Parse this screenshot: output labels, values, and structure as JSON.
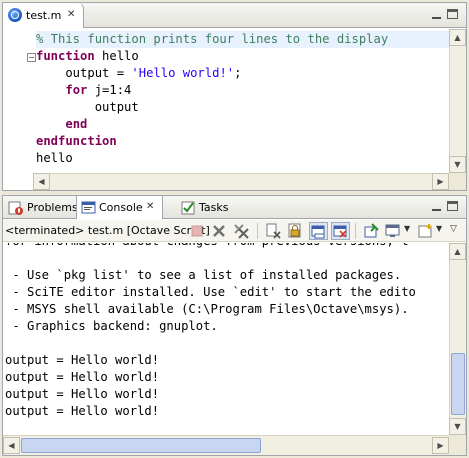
{
  "editor": {
    "tab_label": "test.m",
    "tab_close": "✕",
    "lines": [
      {
        "parts": [
          {
            "text": "% This function prints four lines to the display",
            "cls": "tok-comment"
          }
        ]
      },
      {
        "parts": [
          {
            "text": "function",
            "cls": "tok-kw"
          },
          {
            "text": " hello",
            "cls": ""
          }
        ]
      },
      {
        "parts": [
          {
            "text": "    output = ",
            "cls": ""
          },
          {
            "text": "'Hello world!'",
            "cls": "tok-str"
          },
          {
            "text": ";",
            "cls": ""
          }
        ]
      },
      {
        "parts": [
          {
            "text": "    ",
            "cls": ""
          },
          {
            "text": "for",
            "cls": "tok-kw"
          },
          {
            "text": " j=1:4",
            "cls": ""
          }
        ]
      },
      {
        "parts": [
          {
            "text": "        output",
            "cls": ""
          }
        ]
      },
      {
        "parts": [
          {
            "text": "    ",
            "cls": ""
          },
          {
            "text": "end",
            "cls": "tok-kw"
          }
        ]
      },
      {
        "parts": [
          {
            "text": "endfunction",
            "cls": "tok-kw"
          }
        ]
      },
      {
        "parts": [
          {
            "text": "hello",
            "cls": ""
          }
        ]
      }
    ]
  },
  "views": {
    "tabs": [
      {
        "label": "Problems",
        "icon": "problems-icon"
      },
      {
        "label": "Console",
        "icon": "console-icon",
        "close": "✕"
      },
      {
        "label": "Tasks",
        "icon": "tasks-icon"
      }
    ]
  },
  "console": {
    "title": "<terminated> test.m [Octave Script]",
    "lines": [
      "for information about changes from previous versions, t",
      "",
      " - Use `pkg list' to see a list of installed packages.",
      " - SciTE editor installed. Use `edit' to start the edito",
      " - MSYS shell available (C:\\Program Files\\Octave\\msys).",
      " - Graphics backend: gnuplot.",
      "",
      "output = Hello world!",
      "output = Hello world!",
      "output = Hello world!",
      "output = Hello world!"
    ]
  },
  "colors": {
    "keyword": "#7f0055",
    "comment": "#3f7f5f",
    "string": "#2a00ff"
  }
}
